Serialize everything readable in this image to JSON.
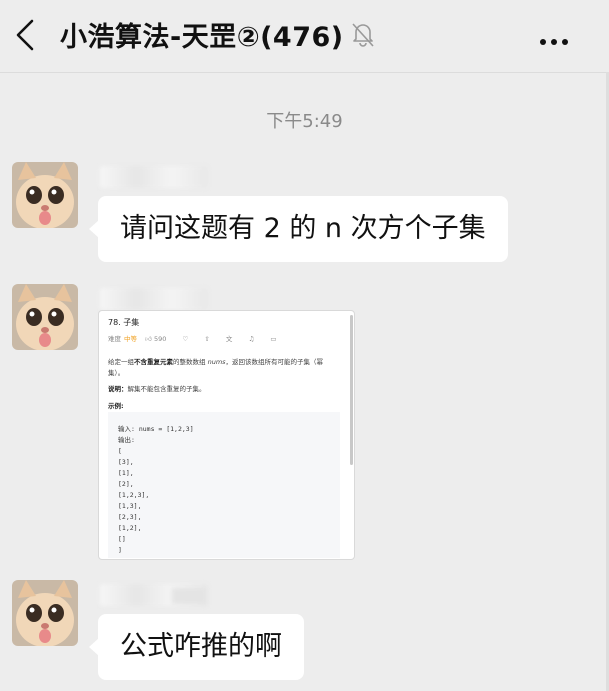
{
  "header": {
    "back_icon": "chevron-left-icon",
    "title": "小浩算法-天罡②(476)",
    "mute_icon": "bell-off-icon",
    "more_icon": "more-dots-icon"
  },
  "timestamp": "下午5:49",
  "messages": [
    {
      "type": "text",
      "text": "请问这题有 2 的 n 次方个子集"
    },
    {
      "type": "image"
    },
    {
      "type": "text",
      "text": "公式咋推的啊"
    }
  ],
  "shared_image": {
    "problem_title": "78. 子集",
    "difficulty_label": "难度",
    "difficulty": "中等",
    "likes": "590",
    "desc_prefix": "给定一组",
    "desc_bold": "不含重复元素",
    "desc_mid": "的整数数组",
    "desc_var": "nums",
    "desc_suffix": "，返回该数组所有可能的子集（幂",
    "desc_line2": "集）。",
    "note_label": "说明：",
    "note_text": "解集不能包含重复的子集。",
    "example_label": "示例:",
    "code_lines": [
      "输入: nums = [1,2,3]",
      "输出:",
      "[",
      "  [3],",
      "  [1],",
      "  [2],",
      "  [1,2,3],",
      "  [1,3],",
      "  [2,3],",
      "  [1,2],",
      "  []",
      "]"
    ]
  }
}
